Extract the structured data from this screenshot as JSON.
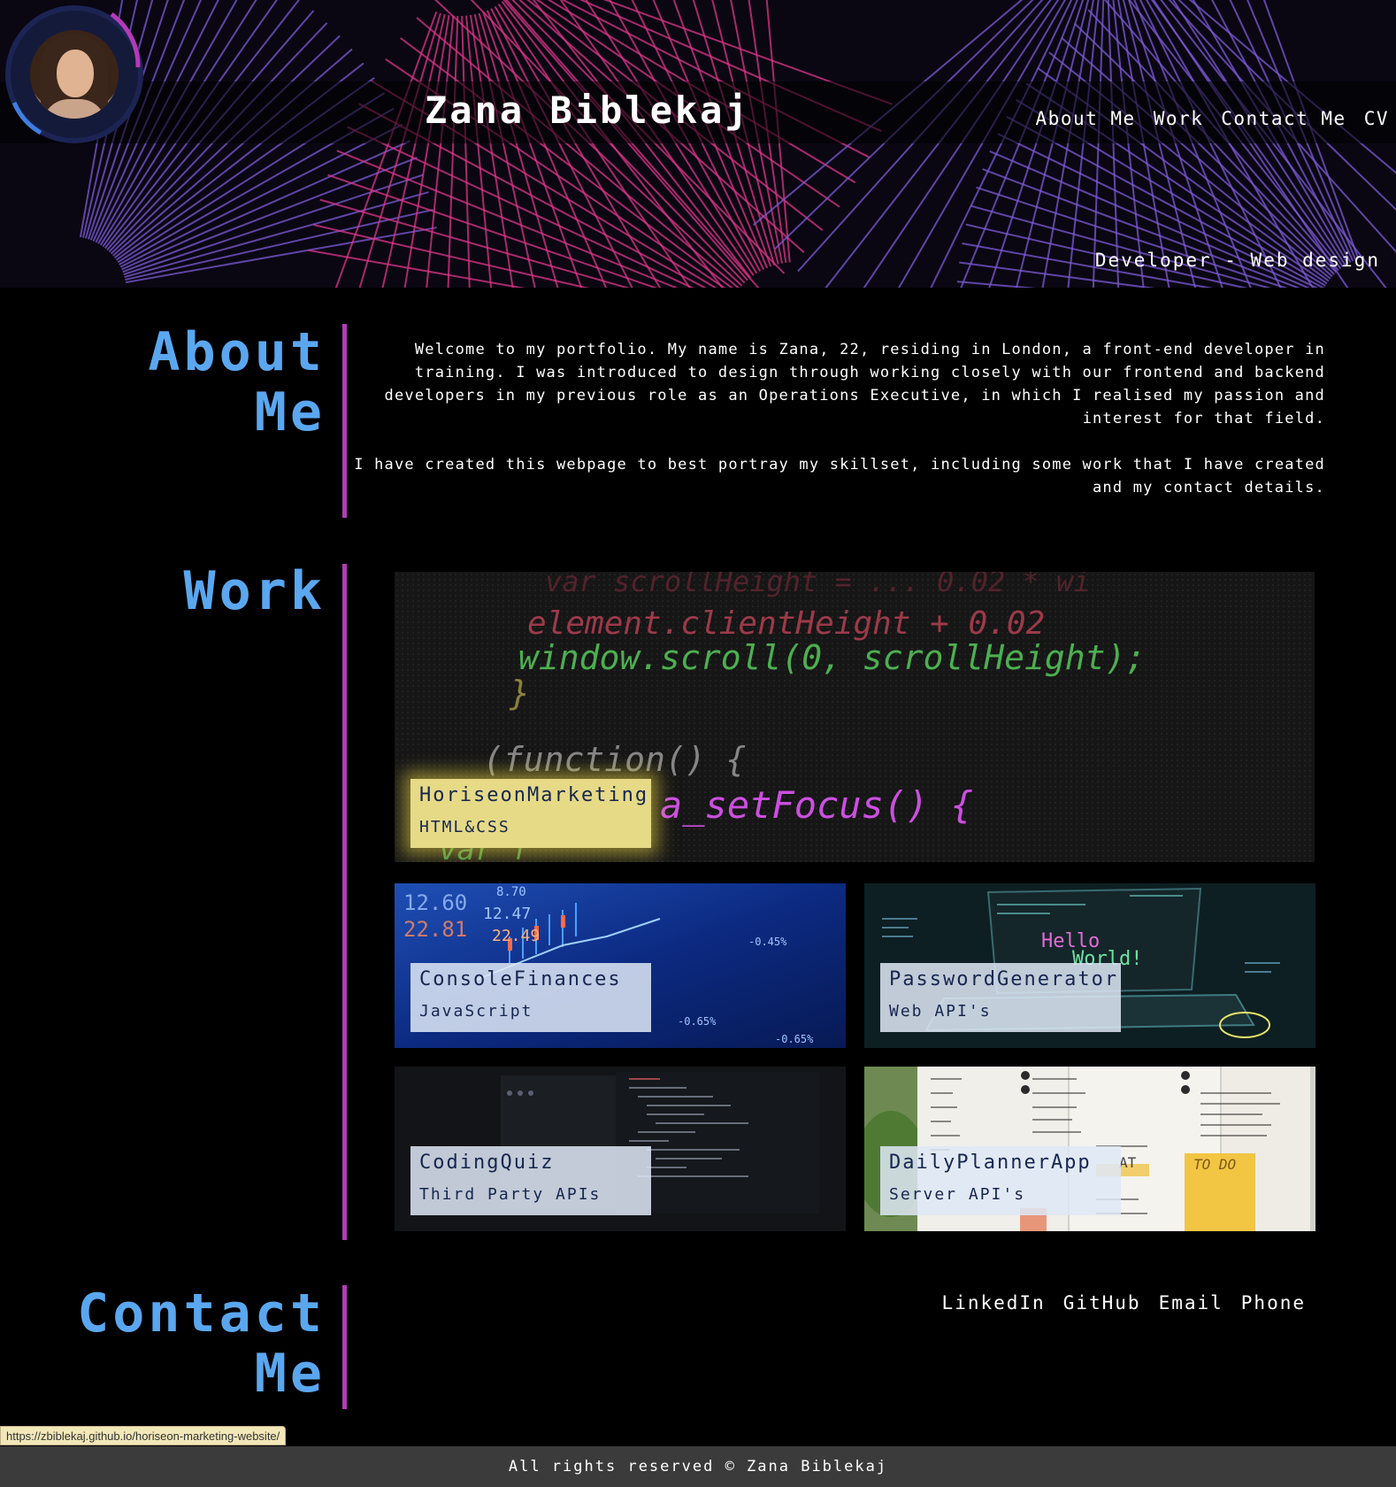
{
  "header": {
    "title": "Zana Biblekaj",
    "nav": [
      "About Me",
      "Work",
      "Contact Me",
      "CV"
    ],
    "tagline": "Developer - Web design"
  },
  "about": {
    "title": "About Me",
    "paragraphs": [
      "Welcome to my portfolio. My name is Zana, 22, residing in London, a front-end developer in training. I was introduced to design through working closely with our frontend and backend developers in my previous role as an Operations Executive, in which I realised my passion and interest for that field.",
      "I have created this webpage to best portray my skillset, including some work that I have created and my contact details."
    ]
  },
  "work": {
    "title": "Work",
    "projects": [
      {
        "name": "HoriseonMarketing",
        "tech": "HTML&CSS"
      },
      {
        "name": "ConsoleFinances",
        "tech": "JavaScript"
      },
      {
        "name": "PasswordGenerator",
        "tech": "Web API's"
      },
      {
        "name": "CodingQuiz",
        "tech": "Third Party APIs"
      },
      {
        "name": "DailyPlannerApp",
        "tech": "Server API's"
      }
    ],
    "screens": {
      "featured_code": [
        "var scrollHeight = ... 0.02 * wi",
        "element.clientHeight + 0.02",
        "window.scroll(0, scrollHeight);",
        "}",
        "(function() {",
        "a_setFocus() {",
        "var f"
      ],
      "finance_ticker": [
        "8.70",
        "12.60",
        "12.47",
        "22.81",
        "22.49",
        "-0.45%",
        "-0.65%",
        "-0.65%"
      ],
      "hello_world": [
        "Hello",
        "World!"
      ],
      "planner_notes": [
        "TO DO",
        "AT"
      ]
    }
  },
  "contact": {
    "title": "Contact Me",
    "links": [
      "LinkedIn",
      "GitHub",
      "Email",
      "Phone"
    ]
  },
  "status_url": "https://zbiblekaj.github.io/horiseon-marketing-website/",
  "footer": "All rights reserved © Zana Biblekaj",
  "colors": {
    "accent_blue": "#5aa7f0",
    "divider_purple": "#b53ab7",
    "header_pink": "#e0358a",
    "header_violet": "#7d5ad8",
    "featured_label": "#e6da87",
    "footer_bg": "#3b3b3b"
  }
}
